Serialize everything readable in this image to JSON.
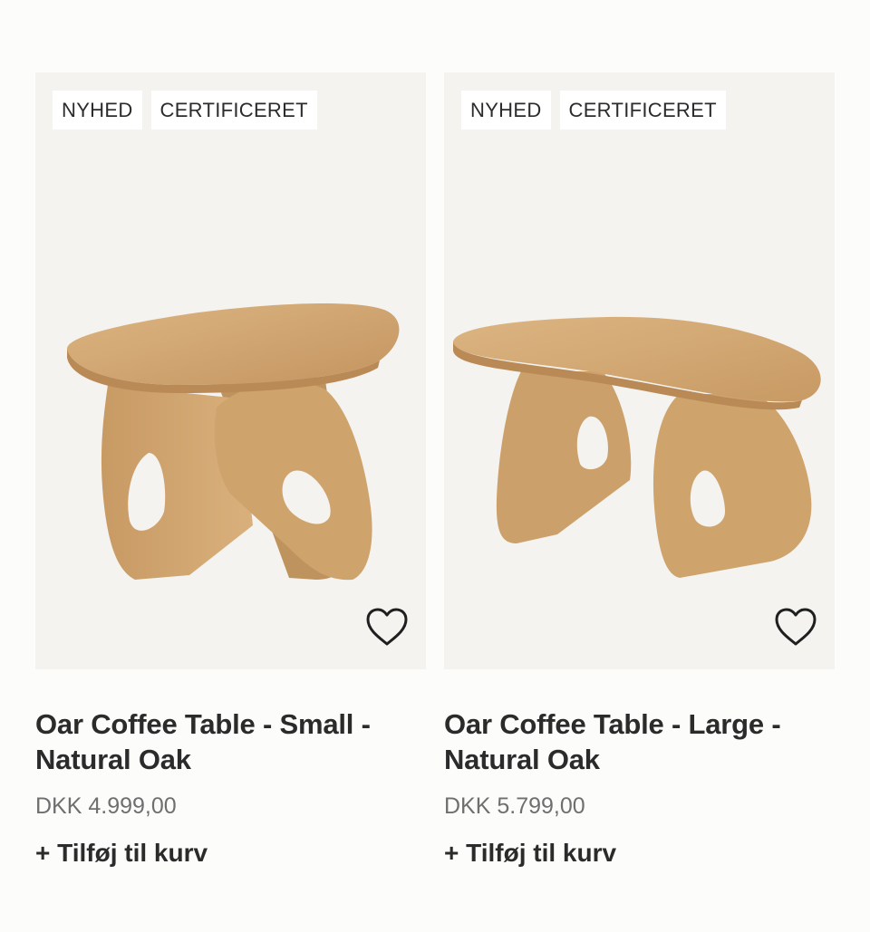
{
  "products": [
    {
      "badges": [
        "NYHED",
        "CERTIFICERET"
      ],
      "image": "oar-coffee-table-small",
      "title": "Oar Coffee Table - Small - Natural Oak",
      "price": "DKK 4.999,00",
      "add_label": "+ Tilføj til kurv",
      "wishlist_icon": "heart-outline-icon"
    },
    {
      "badges": [
        "NYHED",
        "CERTIFICERET"
      ],
      "image": "oar-coffee-table-large",
      "title": "Oar Coffee Table - Large - Natural Oak",
      "price": "DKK 5.799,00",
      "add_label": "+ Tilføj til kurv",
      "wishlist_icon": "heart-outline-icon"
    }
  ],
  "colors": {
    "background": "#fcfcfa",
    "image_bg": "#f4f3f0",
    "badge_bg": "#ffffff",
    "text": "#2b2b2b",
    "price": "#6f6f6f",
    "wood_light": "#d6ad78",
    "wood_dark": "#b88c58"
  }
}
